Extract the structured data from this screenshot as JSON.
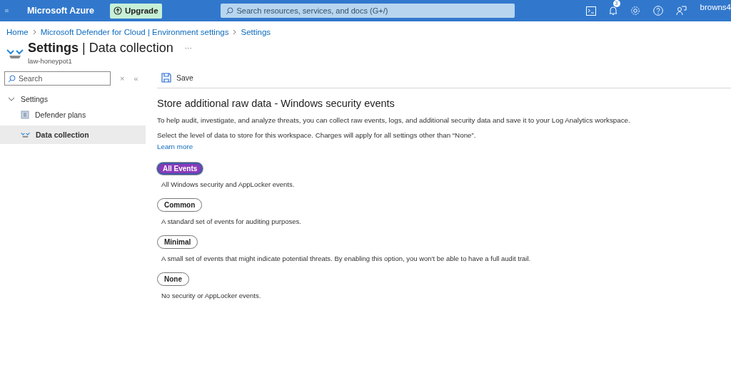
{
  "topbar": {
    "brand": "Microsoft Azure",
    "upgrade": "Upgrade",
    "search_placeholder": "Search resources, services, and docs (G+/)",
    "notifications": "3",
    "user": "browns4"
  },
  "breadcrumb": [
    "Home",
    "Microsoft Defender for Cloud | Environment settings",
    "Settings"
  ],
  "header": {
    "title": "**Settings** | Data collection",
    "resource": "law-honeypot1",
    "more": "···"
  },
  "sidebar": {
    "search_placeholder": "Search",
    "clear": "×",
    "collapse": "«",
    "group": {
      "label": "Settings",
      "expanded": true,
      "children": [
        {
          "label": "Defender plans",
          "selected": false
        },
        {
          "label": "Data collection",
          "selected": true
        }
      ]
    }
  },
  "toolbar": {
    "save": "Save"
  },
  "content": {
    "heading": "Store additional raw data - Windows security events",
    "intro": "To help audit, investigate, and analyze threats, you can collect raw events, logs, and additional security data and save it to your Log Analytics workspace.",
    "select_text": "Select the level of data to store for this workspace. Charges will apply for all settings other than “None”.",
    "learn_more": "Learn more",
    "options": [
      {
        "label": "All Events",
        "selected": true,
        "description": "All Windows security and AppLocker events."
      },
      {
        "label": "Common",
        "selected": false,
        "description": "A standard set of events for auditing purposes."
      },
      {
        "label": "Minimal",
        "selected": false,
        "description": "A small set of events that might indicate potential threats. By enabling this option, you won't be able to have a full audit trail."
      },
      {
        "label": "None",
        "selected": false,
        "description": "No security or AppLocker events."
      }
    ]
  }
}
